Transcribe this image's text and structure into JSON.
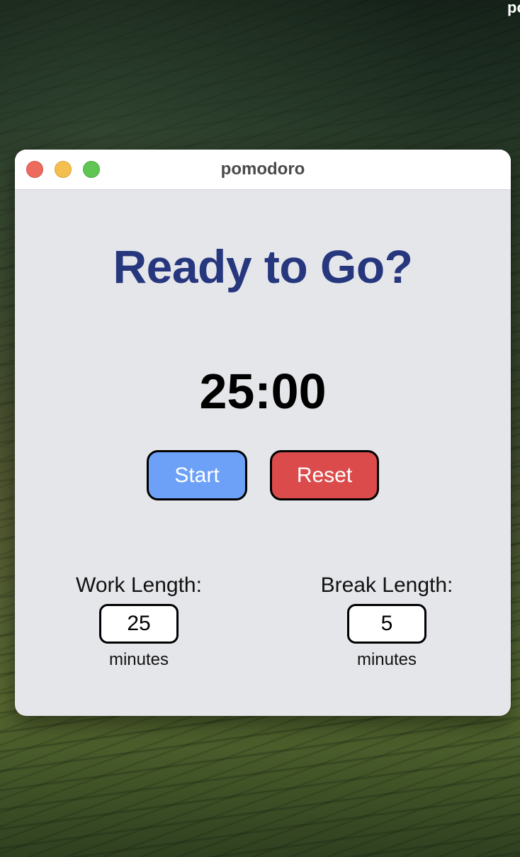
{
  "desktop": {
    "corner_text": "po"
  },
  "window": {
    "title": "pomodoro"
  },
  "main": {
    "heading": "Ready to Go?",
    "timer": "25:00",
    "start_label": "Start",
    "reset_label": "Reset"
  },
  "settings": {
    "work": {
      "label": "Work Length:",
      "value": "25",
      "unit": "minutes"
    },
    "break": {
      "label": "Break Length:",
      "value": "5",
      "unit": "minutes"
    }
  },
  "colors": {
    "heading": "#26377e",
    "start_button": "#6ca1f7",
    "reset_button": "#dc4b4b",
    "window_background": "#e5e6ea",
    "traffic_close": "#ed6a5e",
    "traffic_minimize": "#f5bf4f",
    "traffic_zoom": "#61c554"
  }
}
